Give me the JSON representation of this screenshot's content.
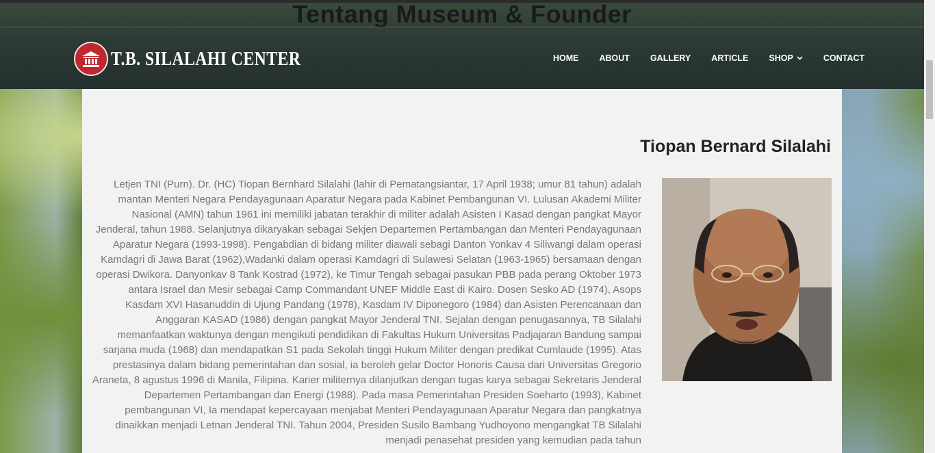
{
  "page": {
    "heading": "Tentang Museum & Founder"
  },
  "logo": {
    "text": "T.B. SILALAHI CENTER",
    "icon": "museum-icon",
    "circle_color": "#c0282d"
  },
  "nav": {
    "items": [
      {
        "label": "HOME"
      },
      {
        "label": "ABOUT"
      },
      {
        "label": "GALLERY"
      },
      {
        "label": "ARTICLE"
      },
      {
        "label": "SHOP",
        "icon": "chevron-down-icon"
      },
      {
        "label": "CONTACT"
      }
    ]
  },
  "profile": {
    "name": "Tiopan Bernard Silalahi",
    "bio": "Letjen TNI (Purn). Dr. (HC) Tiopan Bernhard Silalahi (lahir di Pematangsiantar, 17 April 1938; umur 81 tahun) adalah mantan Menteri Negara Pendayagunaan Aparatur Negara pada Kabinet Pembangunan VI. Lulusan Akademi Militer Nasional (AMN) tahun 1961 ini memiliki jabatan terakhir di militer adalah Asisten I Kasad dengan pangkat Mayor Jenderal, tahun 1988. Selanjutnya dikaryakan sebagai Sekjen Departemen Pertambangan dan Menteri Pendayagunaan Aparatur Negara (1993-1998). Pengabdian di bidang militer diawali sebagi Danton Yonkav 4 Siliwangi dalam operasi Kamdagri di Jawa Barat (1962),Wadanki dalam operasi Kamdagri di Sulawesi Selatan (1963-1965) bersamaan dengan operasi Dwikora. Danyonkav 8 Tank Kostrad (1972), ke Timur Tengah sebagai pasukan PBB pada perang Oktober 1973 antara Israel dan Mesir sebagai Camp Commandant UNEF Middle East di Kairo. Dosen Sesko AD (1974), Asops Kasdam XVI Hasanuddin di Ujung Pandang (1978), Kasdam IV Diponegoro (1984) dan Asisten Perencanaan dan Anggaran KASAD (1986) dengan pangkat Mayor Jenderal TNI. Sejalan dengan penugasannya, TB Silalahi memanfaatkan waktunya dengan mengikuti pendidikan di Fakultas Hukum Universitas Padjajaran Bandung sampai sarjana muda (1968) dan mendapatkan S1 pada Sekolah tinggi Hukum Militer dengan predikat Cumlaude (1995). Atas prestasinya dalam bidang pemerintahan dan sosial, ia beroleh gelar Doctor Honoris Causa dari Universitas Gregorio Araneta, 8 agustus 1996 di Manila, Filipina. Karier militernya dilanjutkan dengan tugas karya sebagai Sekretaris Jenderal Departemen Pertambangan dan Energi (1988). Pada masa Pemerintahan Presiden Soeharto (1993), Kabinet pembangunan VI, Ia mendapat kepercayaan menjabat Menteri Pendayagunaan Aparatur Negara dan pangkatnya dinaikkan menjadi Letnan Jenderal TNI. Tahun 2004, Presiden Susilo Bambang Yudhoyono mengangkat TB Silalahi menjadi penasehat presiden yang kemudian pada tahun"
  }
}
